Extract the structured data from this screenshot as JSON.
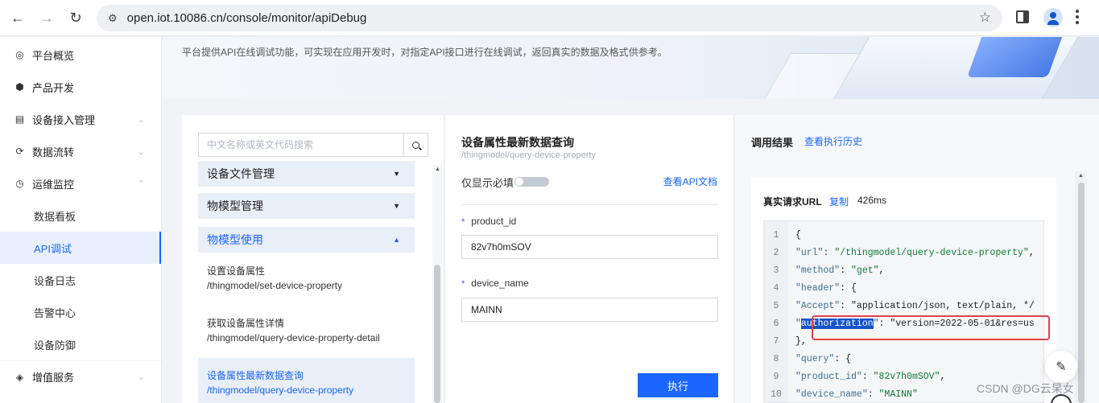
{
  "browser": {
    "url": "open.iot.10086.cn/console/monitor/apiDebug"
  },
  "sidebar": {
    "items": [
      {
        "label": "平台概览",
        "icon": "overview-icon"
      },
      {
        "label": "产品开发",
        "icon": "product-icon"
      },
      {
        "label": "设备接入管理",
        "icon": "device-access-icon"
      },
      {
        "label": "数据流转",
        "icon": "data-flow-icon"
      },
      {
        "label": "运维监控",
        "icon": "monitor-icon"
      }
    ],
    "sub_items": [
      "数据看板",
      "API调试",
      "设备日志",
      "告警中心",
      "设备防御"
    ],
    "bottom_item": {
      "label": "增值服务",
      "icon": "value-added-icon"
    }
  },
  "banner": {
    "description": "平台提供API在线调试功能，可实现在应用开发时，对指定API接口进行在线调试，返回真实的数据及格式供参考。"
  },
  "api_list": {
    "search_placeholder": "中文名称或英文代码搜索",
    "groups": [
      "设备文件管理",
      "物模型管理",
      "物模型使用"
    ],
    "items": [
      {
        "name": "设置设备属性",
        "path": "/thingmodel/set-device-property"
      },
      {
        "name": "获取设备属性详情",
        "path": "/thingmodel/query-device-property-detail"
      },
      {
        "name": "设备属性最新数据查询",
        "path": "/thingmodel/query-device-property"
      }
    ]
  },
  "params": {
    "title": "设备属性最新数据查询",
    "path": "/thingmodel/query-device-property",
    "required_only_label": "仅显示必填",
    "doc_link": "查看API文档",
    "fields": [
      {
        "name": "product_id",
        "value": "82v7h0mSOV"
      },
      {
        "name": "device_name",
        "value": "MAINN"
      }
    ],
    "execute_label": "执行"
  },
  "result": {
    "title": "调用结果",
    "history_link": "查看执行历史",
    "url_label": "真实请求URL",
    "copy_label": "复制",
    "elapsed": "426ms",
    "code_lines": [
      {
        "n": "1",
        "text": "{"
      },
      {
        "n": "2",
        "text": "  \"url\": \"/thingmodel/query-device-property\","
      },
      {
        "n": "3",
        "text": "  \"method\": \"get\","
      },
      {
        "n": "4",
        "text": "  \"header\": {"
      },
      {
        "n": "5",
        "text": "    \"Accept\": \"application/json, text/plain, */"
      },
      {
        "n": "6",
        "text": "    \"authorization\": \"version=2022-05-01&res=us"
      },
      {
        "n": "7",
        "text": "  },"
      },
      {
        "n": "8",
        "text": "  \"query\": {"
      },
      {
        "n": "9",
        "text": "    \"product_id\": \"82v7h0mSOV\","
      },
      {
        "n": "10",
        "text": "    \"device_name\": \"MAINN\""
      }
    ]
  },
  "watermark": "CSDN @DG云杲女",
  "colors": {
    "accent": "#1a66ff",
    "highlight": "#e0424b"
  }
}
